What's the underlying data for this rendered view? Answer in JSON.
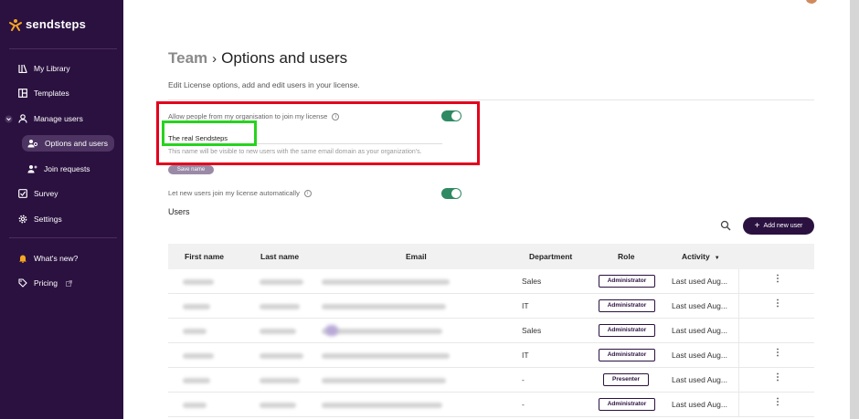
{
  "app": {
    "name": "sendsteps"
  },
  "colors": {
    "sidebar": "#2b1140",
    "toggle_on": "#2e8a63",
    "highlight_red": "#e3001b",
    "highlight_green": "#27d31e"
  },
  "sidebar": {
    "items": [
      {
        "label": "My Library",
        "icon": "library-icon"
      },
      {
        "label": "Templates",
        "icon": "templates-icon"
      },
      {
        "label": "Manage users",
        "icon": "user-icon"
      },
      {
        "label": "Options and users",
        "icon": "users-gear-icon"
      },
      {
        "label": "Join requests",
        "icon": "user-plus-icon"
      },
      {
        "label": "Survey",
        "icon": "survey-check-icon"
      },
      {
        "label": "Settings",
        "icon": "gear-icon"
      },
      {
        "label": "What's new?",
        "icon": "bell-icon"
      },
      {
        "label": "Pricing",
        "icon": "tag-icon"
      }
    ]
  },
  "header": {
    "breadcrumb_link": "Team",
    "breadcrumb_sep": "›",
    "breadcrumb_current": "Options and users",
    "subtitle": "Edit License options, add and edit users in your license."
  },
  "settings": {
    "allow_join_label": "Allow people from my organisation to join my license",
    "allow_join_enabled": true,
    "org_name_value": "The real Sendsteps",
    "org_name_hint": "This name will be visible to new users with the same email domain as your organization's.",
    "save_label": "Save name",
    "auto_join_label": "Let new users join my license automatically",
    "auto_join_enabled": true
  },
  "users": {
    "title": "Users",
    "add_label": "Add new user",
    "columns": [
      "First name",
      "Last name",
      "Email",
      "Department",
      "Role",
      "Activity"
    ],
    "activity_sort": "▼",
    "rows": [
      {
        "department": "Sales",
        "role": "Administrator",
        "activity": "Last used Aug...",
        "menu": "⋮"
      },
      {
        "department": "IT",
        "role": "Administrator",
        "activity": "Last used Aug...",
        "menu": "⋮"
      },
      {
        "department": "Sales",
        "role": "Administrator",
        "activity": "Last used Aug...",
        "menu": ""
      },
      {
        "department": "IT",
        "role": "Administrator",
        "activity": "Last used Aug...",
        "menu": "⋮"
      },
      {
        "department": "-",
        "role": "Presenter",
        "activity": "Last used Aug...",
        "menu": "⋮"
      },
      {
        "department": "-",
        "role": "Administrator",
        "activity": "Last used Aug...",
        "menu": "⋮"
      }
    ]
  }
}
